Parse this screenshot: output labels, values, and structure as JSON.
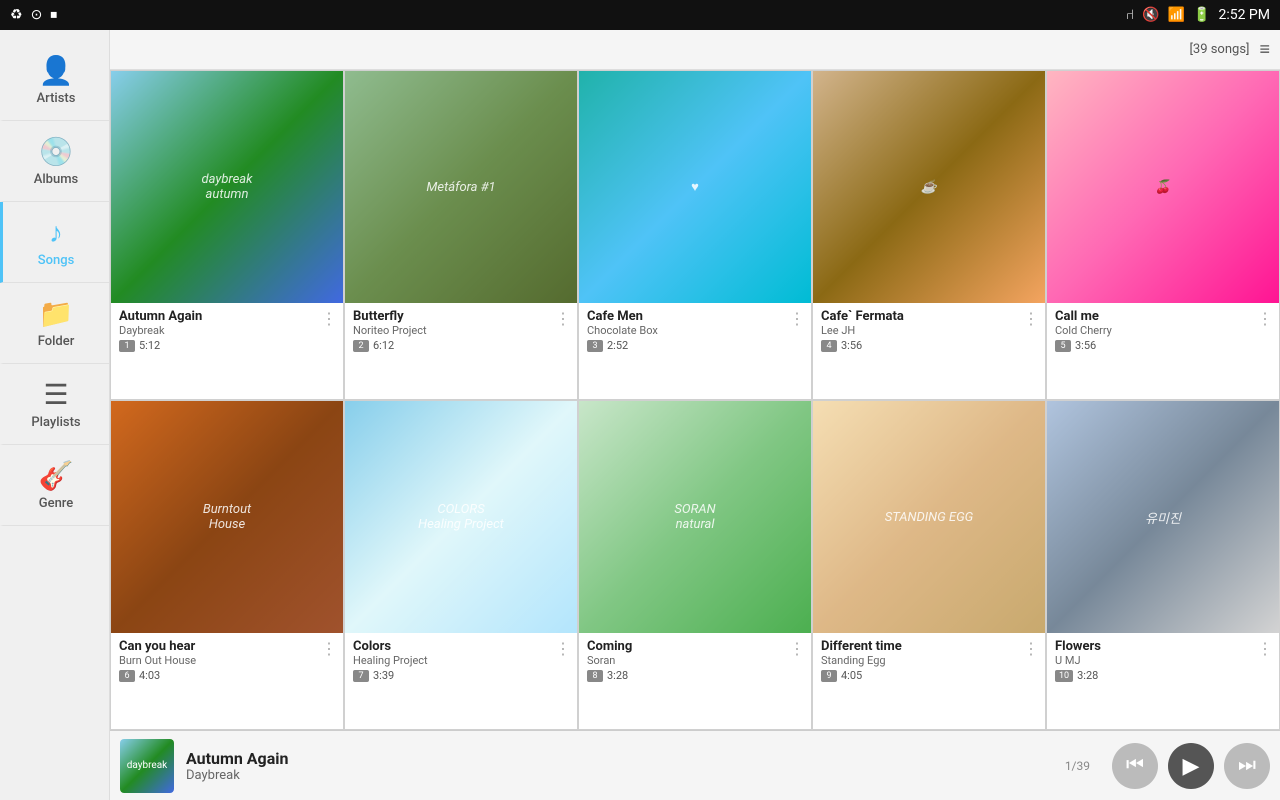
{
  "statusBar": {
    "time": "2:52 PM",
    "icons": [
      "♻",
      "⊙",
      "⏹",
      "🔋",
      "📶",
      "🔇",
      "⑁"
    ]
  },
  "topBar": {
    "songsCount": "[39 songs]",
    "listIcon": "≡"
  },
  "sidebar": {
    "items": [
      {
        "id": "artists",
        "label": "Artists",
        "icon": "👤",
        "active": false
      },
      {
        "id": "albums",
        "label": "Albums",
        "icon": "💿",
        "active": false
      },
      {
        "id": "songs",
        "label": "Songs",
        "icon": "♪",
        "active": true
      },
      {
        "id": "folder",
        "label": "Folder",
        "icon": "📁",
        "active": false
      },
      {
        "id": "playlists",
        "label": "Playlists",
        "icon": "☰",
        "active": false
      },
      {
        "id": "genre",
        "label": "Genre",
        "icon": "🎸",
        "active": false
      }
    ]
  },
  "albums": [
    {
      "id": 1,
      "title": "Autumn Again",
      "artist": "Daybreak",
      "num": 1,
      "duration": "5:12",
      "color": "c1",
      "text": "daybreak\nautumn"
    },
    {
      "id": 2,
      "title": "Butterfly",
      "artist": "Noriteo Project",
      "num": 2,
      "duration": "6:12",
      "color": "c2",
      "text": "Metáfora #1"
    },
    {
      "id": 3,
      "title": "Cafe Men",
      "artist": "Chocolate Box",
      "num": 3,
      "duration": "2:52",
      "color": "c3",
      "text": "♥"
    },
    {
      "id": 4,
      "title": "Cafe` Fermata",
      "artist": "Lee JH",
      "num": 4,
      "duration": "3:56",
      "color": "c4",
      "text": "☕"
    },
    {
      "id": 5,
      "title": "Call me",
      "artist": "Cold Cherry",
      "num": 5,
      "duration": "3:56",
      "color": "c5",
      "text": "🍒"
    },
    {
      "id": 6,
      "title": "Can you hear",
      "artist": "Burn Out House",
      "num": 6,
      "duration": "4:03",
      "color": "c6",
      "text": "Burntout\nHouse"
    },
    {
      "id": 7,
      "title": "Colors",
      "artist": "Healing Project",
      "num": 7,
      "duration": "3:39",
      "color": "c7",
      "text": "COLORS\nHealing Project"
    },
    {
      "id": 8,
      "title": "Coming",
      "artist": "Soran",
      "num": 8,
      "duration": "3:28",
      "color": "c8",
      "text": "SORAN\nnatural"
    },
    {
      "id": 9,
      "title": "Different time",
      "artist": "Standing Egg",
      "num": 9,
      "duration": "4:05",
      "color": "c9",
      "text": "STANDING EGG"
    },
    {
      "id": 10,
      "title": "Flowers",
      "artist": "U MJ",
      "num": 10,
      "duration": "3:28",
      "color": "c10",
      "text": "유미진"
    }
  ],
  "nowPlaying": {
    "title": "Autumn Again",
    "artist": "Daybreak",
    "counter": "1/39",
    "prevLabel": "⏮",
    "playLabel": "▶",
    "nextLabel": "⏭"
  }
}
